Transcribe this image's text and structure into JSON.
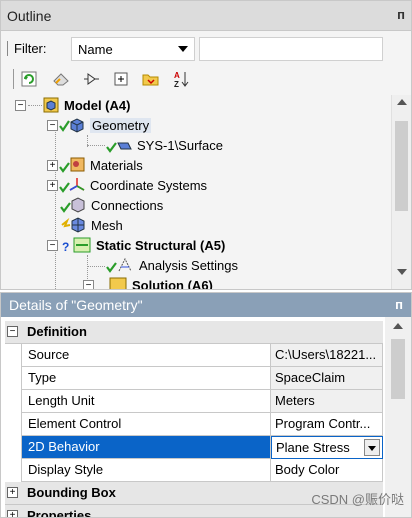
{
  "outline": {
    "title": "Outline",
    "pin": "ᴨ",
    "filter_label": "Filter:",
    "filter_value": "Name",
    "filter_text": ""
  },
  "toolbar": {
    "icons": [
      "refresh-icon",
      "eraser-icon",
      "gate-icon",
      "plus-square-icon",
      "folder-icon",
      "sort-az-icon"
    ]
  },
  "tree": {
    "model": "Model (A4)",
    "geometry": "Geometry",
    "surface": "SYS-1\\Surface",
    "materials": "Materials",
    "coordinate_systems": "Coordinate Systems",
    "connections": "Connections",
    "mesh": "Mesh",
    "static_structural": "Static Structural (A5)",
    "analysis_settings": "Analysis Settings",
    "solution": "Solution (A6)"
  },
  "details": {
    "title": "Details of \"Geometry\"",
    "pin": "ᴨ",
    "categories": {
      "definition": "Definition",
      "bounding_box": "Bounding Box",
      "properties": "Properties"
    },
    "rows": [
      {
        "label": "Source",
        "value": "C:\\Users\\18221..."
      },
      {
        "label": "Type",
        "value": "SpaceClaim"
      },
      {
        "label": "Length Unit",
        "value": "Meters"
      },
      {
        "label": "Element Control",
        "value": "Program Contr..."
      },
      {
        "label": "2D Behavior",
        "value": "Plane Stress"
      },
      {
        "label": "Display Style",
        "value": "Body Color"
      }
    ]
  },
  "watermark": "CSDN @赈价哒",
  "colors": {
    "selection": "#0a64c8",
    "details_header": "#8aa0b7",
    "check": "#2a9d2a"
  }
}
